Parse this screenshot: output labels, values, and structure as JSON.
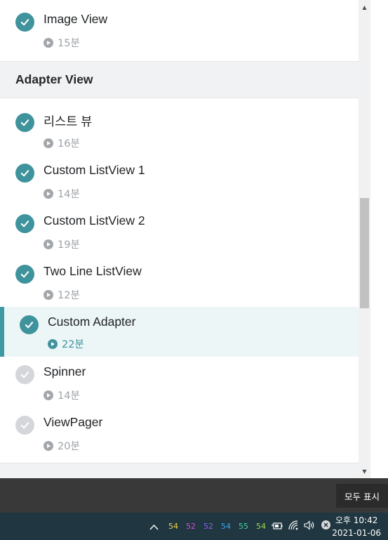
{
  "lessons_top": [
    {
      "title": "Image View",
      "duration": "15분",
      "done": true
    }
  ],
  "section": {
    "title": "Adapter View"
  },
  "lessons": [
    {
      "title": "리스트 뷰",
      "duration": "16분",
      "done": true
    },
    {
      "title": "Custom ListView 1",
      "duration": "14분",
      "done": true
    },
    {
      "title": "Custom ListView 2",
      "duration": "19분",
      "done": true
    },
    {
      "title": "Two Line ListView",
      "duration": "12분",
      "done": true
    },
    {
      "title": "Custom Adapter",
      "duration": "22분",
      "done": true,
      "active": true
    },
    {
      "title": "Spinner",
      "duration": "14분",
      "done": false
    },
    {
      "title": "ViewPager",
      "duration": "20분",
      "done": false
    }
  ],
  "colors": {
    "accent": "#3f939c",
    "active_bg": "#edf6f7",
    "pending": "#d4d6da",
    "taskbar": "#203640"
  },
  "notification": {
    "show_all_label": "모두 표시"
  },
  "tray": {
    "numbers": [
      {
        "value": "54",
        "color": "#f1d54a"
      },
      {
        "value": "52",
        "color": "#d44ed8"
      },
      {
        "value": "52",
        "color": "#8a63f0"
      },
      {
        "value": "54",
        "color": "#37a8f2"
      },
      {
        "value": "55",
        "color": "#42d6a3"
      },
      {
        "value": "54",
        "color": "#9ad84b"
      }
    ],
    "icons": [
      "chevron-up-icon",
      "battery-plug-icon",
      "wifi-icon",
      "volume-icon",
      "close-circle-icon"
    ],
    "clock_time": "오후 10:42",
    "clock_date": "2021-01-06"
  }
}
